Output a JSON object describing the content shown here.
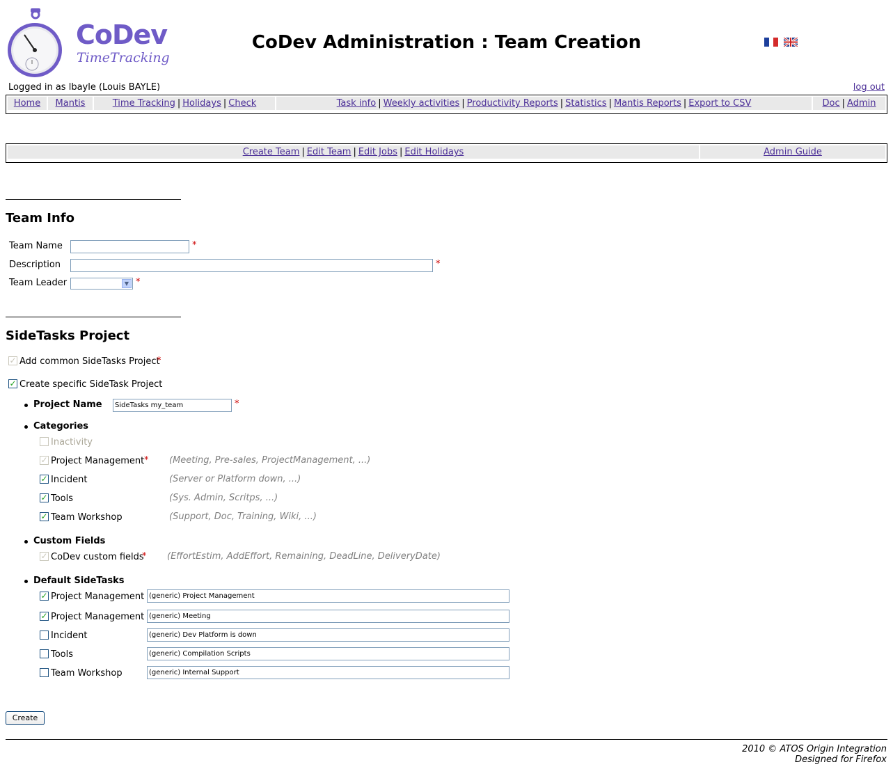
{
  "header": {
    "logo_title": "CoDev",
    "logo_subtitle": "TimeTracking",
    "page_title": "CoDev Administration : Team Creation",
    "logged_in": "Logged in as lbayle (Louis BAYLE)",
    "logout": "log out",
    "flags": [
      "flag-fr-icon",
      "flag-gb-icon"
    ]
  },
  "menu": {
    "home": "Home",
    "mantis": "Mantis",
    "time_tracking": "Time Tracking",
    "holidays": "Holidays",
    "check": "Check",
    "task_info": "Task info",
    "weekly_activities": "Weekly activities",
    "productivity_reports": "Productivity Reports",
    "statistics": "Statistics",
    "mantis_reports": "Mantis Reports",
    "export_csv": "Export to CSV",
    "doc": "Doc",
    "admin": "Admin",
    "separator": "|"
  },
  "admin_menu": {
    "create_team": "Create Team",
    "edit_team": "Edit Team",
    "edit_jobs": "Edit Jobs",
    "edit_holidays": "Edit Holidays",
    "admin_guide": "Admin Guide"
  },
  "team_info": {
    "title": "Team Info",
    "team_name_label": "Team Name",
    "team_name_value": "",
    "description_label": "Description",
    "description_value": "",
    "team_leader_label": "Team Leader",
    "team_leader_value": "",
    "required_mark": "*"
  },
  "sidetasks": {
    "title": "SideTasks Project",
    "add_common_label": "Add common SideTasks Project",
    "add_common_checked": true,
    "create_specific_label": "Create specific SideTask Project",
    "create_specific_checked": true,
    "project_name_label": "Project Name",
    "project_name_value": "SideTasks my_team",
    "categories_label": "Categories",
    "categories": [
      {
        "label": "Inactivity",
        "checked": false,
        "disabled": true,
        "hint": "",
        "required": false
      },
      {
        "label": "Project Management",
        "checked": true,
        "disabled": true,
        "hint": "(Meeting, Pre-sales, ProjectManagement, ...)",
        "required": true
      },
      {
        "label": "Incident",
        "checked": true,
        "disabled": false,
        "hint": "(Server or Platform down, ...)",
        "required": false
      },
      {
        "label": "Tools",
        "checked": true,
        "disabled": false,
        "hint": "(Sys. Admin, Scritps, ...)",
        "required": false
      },
      {
        "label": "Team Workshop",
        "checked": true,
        "disabled": false,
        "hint": "(Support, Doc, Training, Wiki, ...)",
        "required": false
      }
    ],
    "custom_fields_label": "Custom Fields",
    "custom_field": {
      "label": "CoDev custom fields",
      "checked": true,
      "disabled": true,
      "hint": "(EffortEstim, AddEffort, Remaining, DeadLine, DeliveryDate)"
    },
    "default_sidetasks_label": "Default SideTasks",
    "default_sidetasks": [
      {
        "label": "Project Management",
        "checked": true,
        "value": "(generic) Project Management"
      },
      {
        "label": "Project Management",
        "checked": true,
        "value": "(generic) Meeting"
      },
      {
        "label": "Incident",
        "checked": false,
        "value": "(generic) Dev Platform is down"
      },
      {
        "label": "Tools",
        "checked": false,
        "value": "(generic) Compilation Scripts"
      },
      {
        "label": "Team Workshop",
        "checked": false,
        "value": "(generic) Internal Support"
      }
    ]
  },
  "actions": {
    "create": "Create"
  },
  "footer": {
    "copyright": "2010 © ATOS Origin Integration",
    "designed": "Designed for Firefox"
  }
}
